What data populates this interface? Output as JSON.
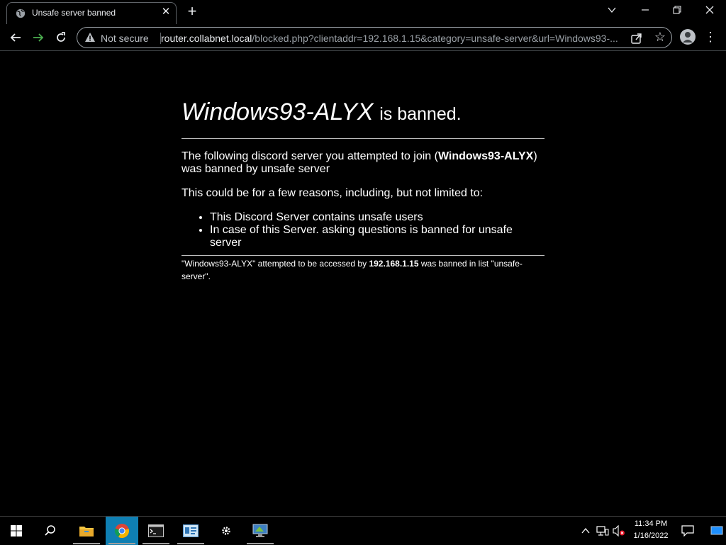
{
  "browser": {
    "tab_title": "Unsafe server banned",
    "new_tab_label": "+",
    "security_label": "Not secure",
    "url_host": "router.collabnet.local",
    "url_path": "/blocked.php?clientaddr=192.168.1.15&category=unsafe-server&url=Windows93-..."
  },
  "page": {
    "heading_site": "Windows93-ALYX",
    "heading_suffix": "is banned.",
    "p1_prefix": "The following discord server you attempted to join (",
    "p1_server": "Windows93-ALYX",
    "p1_suffix": ") was banned by unsafe server",
    "p2": "This could be for a few reasons, including, but not limited to:",
    "reasons": [
      "This Discord Server contains unsafe users",
      "In case of this Server. asking questions is banned for unsafe server"
    ],
    "footer_prefix": "\"Windows93-ALYX\" attempted to be accessed by ",
    "footer_ip": "192.168.1.15",
    "footer_suffix": " was banned in list \"unsafe-server\"."
  },
  "taskbar": {
    "time": "11:34 PM",
    "date": "1/16/2022",
    "apps": [
      "start",
      "search",
      "file-explorer",
      "chrome",
      "command-prompt",
      "server-manager",
      "settings",
      "remote-desktop"
    ]
  },
  "colors": {
    "page_bg": "#000000",
    "text": "#ffffff",
    "taskbar_active": "#0f7fb3"
  }
}
